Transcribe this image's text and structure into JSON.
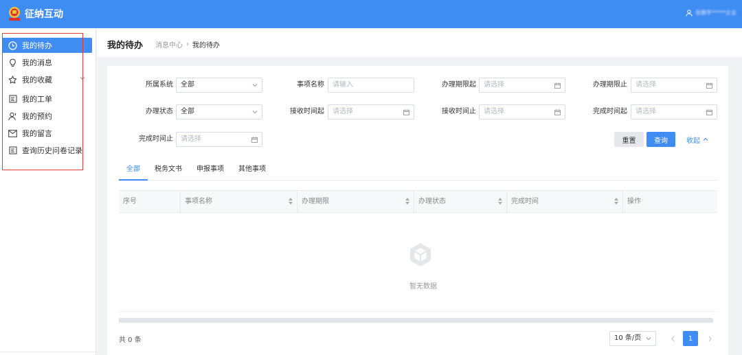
{
  "header": {
    "app_title": "征纳互动",
    "user_name": "张静宇*****企业"
  },
  "sidebar": {
    "items": [
      {
        "label": "我的待办",
        "icon": "clock-icon",
        "active": true
      },
      {
        "label": "我的消息",
        "icon": "lightbulb-icon"
      },
      {
        "label": "我的收藏",
        "icon": "star-icon",
        "has_children": true
      },
      {
        "label": "我的工单",
        "icon": "document-icon"
      },
      {
        "label": "我的预约",
        "icon": "user-icon"
      },
      {
        "label": "我的留言",
        "icon": "mail-icon"
      },
      {
        "label": "查询历史问卷记录",
        "icon": "document-icon"
      }
    ]
  },
  "page": {
    "title": "我的待办",
    "breadcrumb": [
      "消息中心",
      "我的待办"
    ]
  },
  "filters": {
    "system_label": "所属系统",
    "system_value": "全部",
    "item_name_label": "事项名称",
    "item_name_placeholder": "请输入",
    "deadline_start_label": "办理期限起",
    "deadline_end_label": "办理期限止",
    "status_label": "办理状态",
    "status_value": "全部",
    "receive_start_label": "接收时间起",
    "receive_end_label": "接收时间止",
    "complete_start_label": "完成时间起",
    "complete_end_label": "完成时间止",
    "date_placeholder": "请选择",
    "reset_label": "重置",
    "query_label": "查询",
    "collapse_label": "收起"
  },
  "tabs": [
    "全部",
    "税务文书",
    "申报事项",
    "其他事项"
  ],
  "table": {
    "columns": [
      "序号",
      "事项名称",
      "办理期限",
      "办理状态",
      "完成时间",
      "操作"
    ],
    "empty_text": "暂无数据"
  },
  "pagination": {
    "total_text": "共 0 条",
    "page_size": "10 条/页",
    "current_page": "1"
  },
  "colors": {
    "primary": "#3f8cf3",
    "highlight_border": "#e23b3b"
  }
}
